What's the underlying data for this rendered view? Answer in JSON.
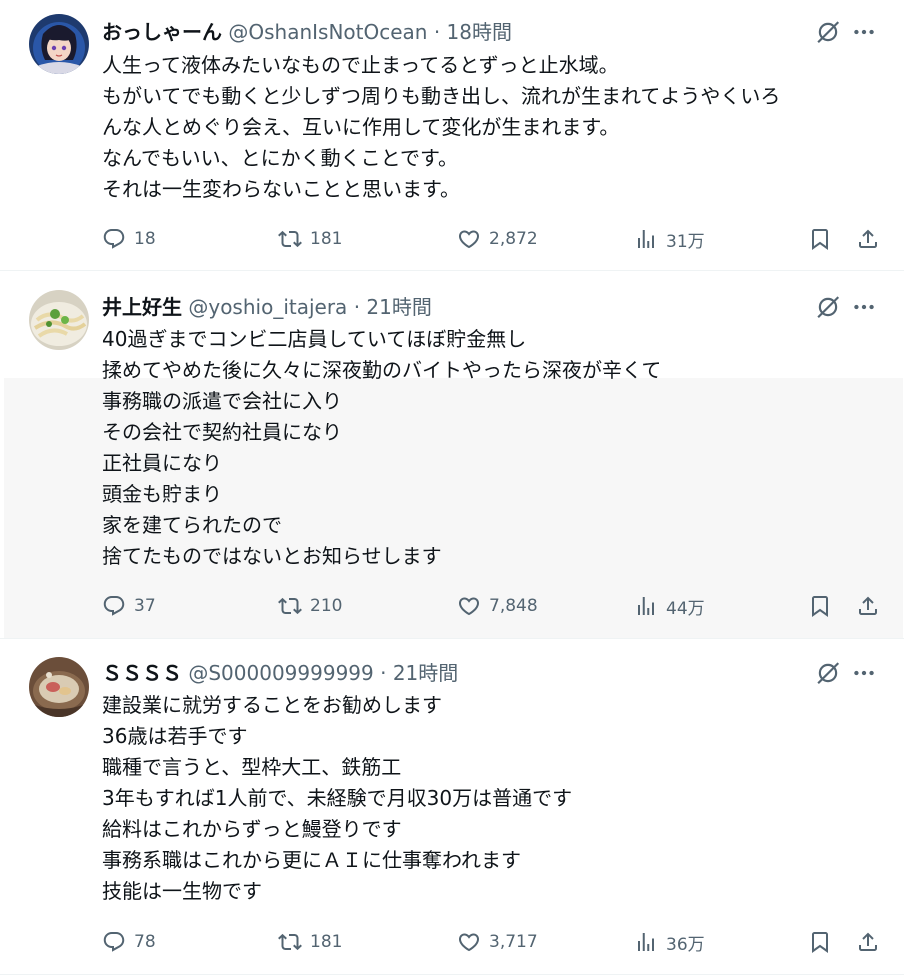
{
  "tweets": [
    {
      "display_name": "おっしゃーん",
      "handle": "@OshanIsNotOcean",
      "time": "18時間",
      "lines": [
        "人生って液体みたいなもので止まってるとずっと止水域。",
        "もがいてでも動くと少しずつ周りも動き出し、流れが生まれてようやくいろ",
        "んな人とめぐり会え、互いに作用して変化が生まれます。",
        "なんでもいい、とにかく動くことです。",
        "それは一生変わらないことと思います。"
      ],
      "replies": "18",
      "reposts": "181",
      "likes": "2,872",
      "views": "31万"
    },
    {
      "display_name": "井上好生",
      "handle": "@yoshio_itajera",
      "time": "21時間",
      "lines": [
        "40過ぎまでコンビ二店員していてほぼ貯金無し",
        "揉めてやめた後に久々に深夜勤のバイトやったら深夜が辛くて",
        "事務職の派遣で会社に入り",
        "その会社で契約社員になり",
        "正社員になり",
        "頭金も貯まり",
        "家を建てられたので",
        "捨てたものではないとお知らせします"
      ],
      "replies": "37",
      "reposts": "210",
      "likes": "7,848",
      "views": "44万"
    },
    {
      "display_name": "ＳＳＳＳ",
      "handle": "@S000009999999",
      "time": "21時間",
      "lines": [
        "建設業に就労することをお勧めします",
        "36歳は若手です",
        "職種で言うと、型枠大工、鉄筋工",
        "3年もすれば1人前で、未経験で月収30万は普通です",
        "給料はこれからずっと鰻登りです",
        "事務系職はこれから更にＡＩに仕事奪われます",
        "技能は一生物です"
      ],
      "replies": "78",
      "reposts": "181",
      "likes": "3,717",
      "views": "36万"
    }
  ],
  "separator": "·",
  "colors": {
    "text": "#0f1419",
    "muted": "#536471",
    "divider": "#eff3f4"
  },
  "icons": {
    "reply": "reply-icon",
    "repost": "repost-icon",
    "like": "heart-icon",
    "views": "views-icon",
    "bookmark": "bookmark-icon",
    "share": "share-icon",
    "grok": "grok-icon",
    "more": "more-icon"
  }
}
